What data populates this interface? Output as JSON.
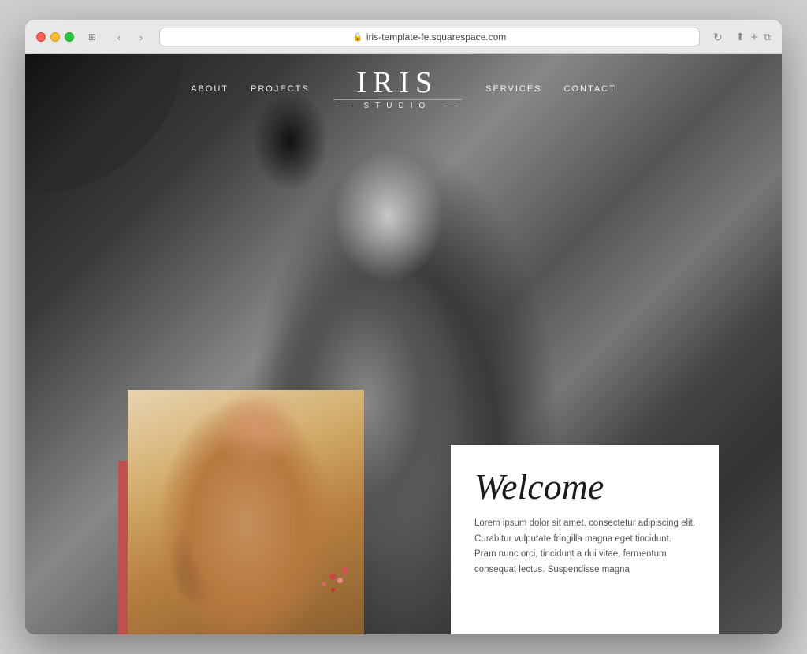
{
  "browser": {
    "url": "iris-template-fe.squarespace.com",
    "traffic_lights": [
      "red",
      "yellow",
      "green"
    ]
  },
  "nav": {
    "left_links": [
      "ABOUT",
      "PROJECTS"
    ],
    "right_links": [
      "SERVICES",
      "CONTACT"
    ],
    "logo_main": "IRIS",
    "logo_sub": "STUDIO"
  },
  "hero": {
    "photo_alt": "Black and white photo of woman with flowing hair"
  },
  "welcome": {
    "heading": "Welcome",
    "body_text": "Lorem ipsum dolor sit amet, consectetur adipiscing elit. Curabitur vulputate fringilla magna eget tincidunt. Praın nunc orci, tincidunt a dui vitae, fermentum consequat lectus. Suspendisse magna"
  }
}
